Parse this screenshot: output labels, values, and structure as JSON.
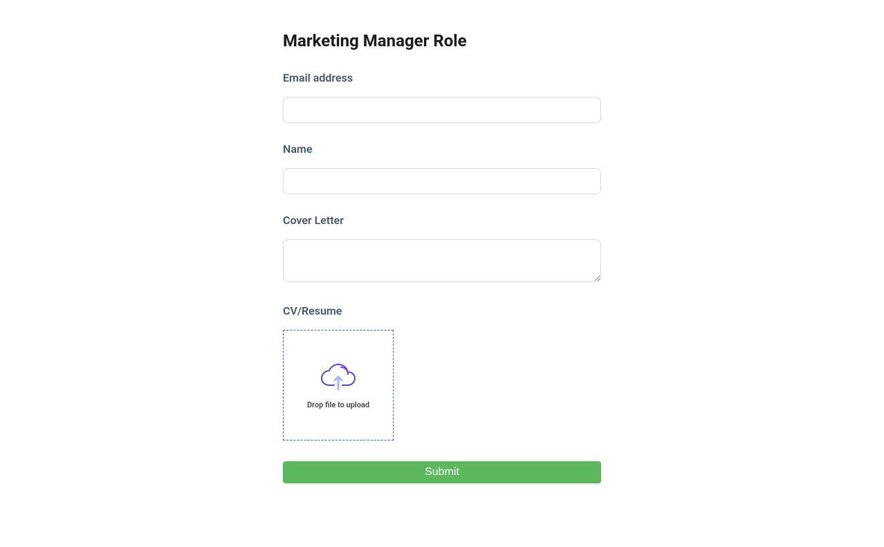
{
  "page": {
    "title": "Marketing Manager Role"
  },
  "form": {
    "email": {
      "label": "Email address",
      "value": ""
    },
    "name": {
      "label": "Name",
      "value": ""
    },
    "cover_letter": {
      "label": "Cover Letter",
      "value": ""
    },
    "cv": {
      "label": "CV/Resume",
      "upload_text": "Drop file to upload"
    },
    "submit_label": "Submit"
  }
}
